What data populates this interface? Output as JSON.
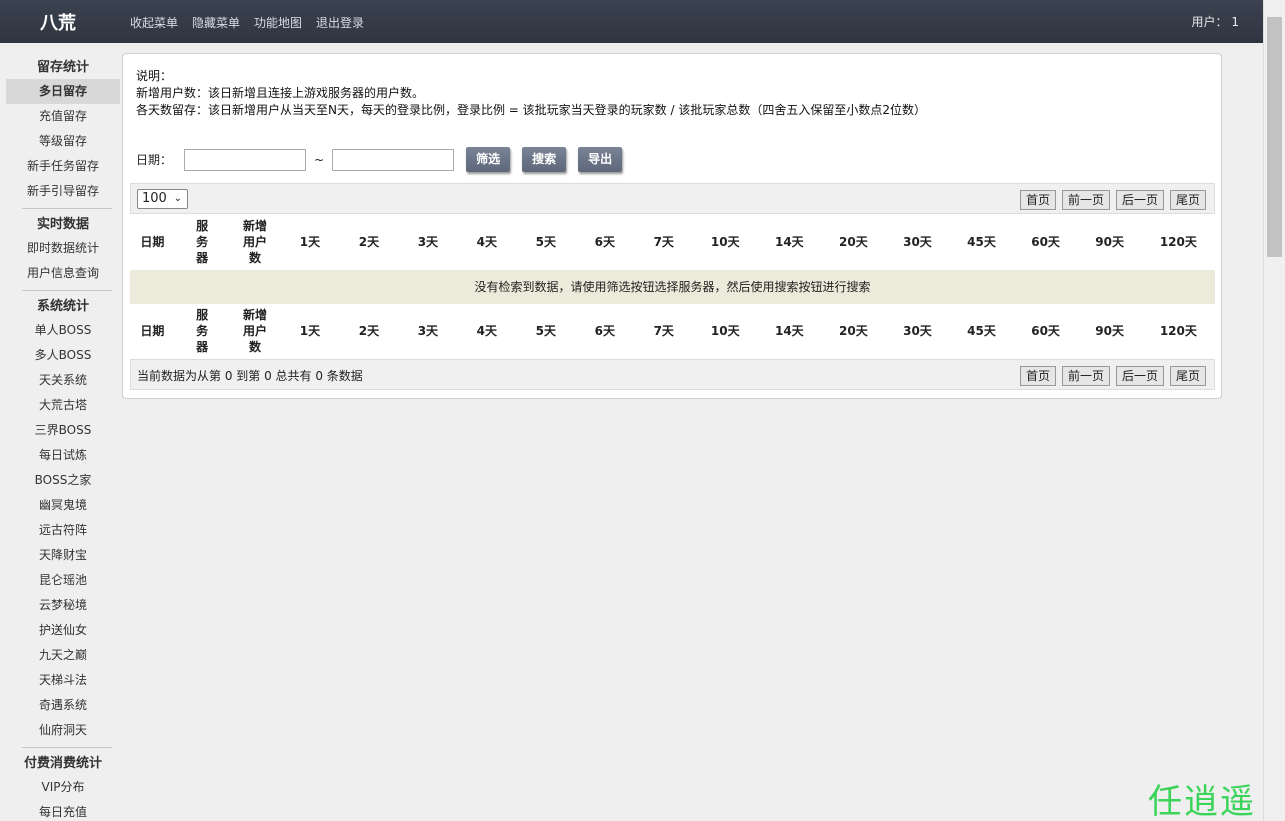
{
  "header": {
    "brand": "八荒",
    "nav": [
      "收起菜单",
      "隐藏菜单",
      "功能地图",
      "退出登录"
    ],
    "user": "用户： 1"
  },
  "sidebar": {
    "groups": [
      {
        "title": "留存统计",
        "items": [
          "多日留存",
          "充值留存",
          "等级留存",
          "新手任务留存",
          "新手引导留存"
        ],
        "active": 0
      },
      {
        "title": "实时数据",
        "items": [
          "即时数据统计",
          "用户信息查询"
        ]
      },
      {
        "title": "系统统计",
        "items": [
          "单人BOSS",
          "多人BOSS",
          "天关系统",
          "大荒古塔",
          "三界BOSS",
          "每日试炼",
          "BOSS之家",
          "幽冥鬼境",
          "远古符阵",
          "天降财宝",
          "昆仑瑶池",
          "云梦秘境",
          "护送仙女",
          "九天之巅",
          "天梯斗法",
          "奇遇系统",
          "仙府洞天"
        ]
      },
      {
        "title": "付费消费统计",
        "items": [
          "VIP分布",
          "每日充值"
        ]
      }
    ]
  },
  "description": {
    "line1": "说明：",
    "line2": "新增用户数：该日新增且连接上游戏服务器的用户数。",
    "line3": "各天数留存：该日新增用户从当天至N天，每天的登录比例，登录比例 = 该批玩家当天登录的玩家数 / 该批玩家总数（四舍五入保留至小数点2位数）"
  },
  "filter": {
    "date_label": "日期：",
    "tilde": "~",
    "filter_btn": "筛选",
    "search_btn": "搜索",
    "export_btn": "导出"
  },
  "table": {
    "page_size": "100",
    "pager": [
      "首页",
      "前一页",
      "后一页",
      "尾页"
    ],
    "columns": [
      "日期",
      "服务器",
      "新增用户数",
      "1天",
      "2天",
      "3天",
      "4天",
      "5天",
      "6天",
      "7天",
      "10天",
      "14天",
      "20天",
      "30天",
      "45天",
      "60天",
      "90天",
      "120天"
    ],
    "empty_message": "没有检索到数据，请使用筛选按钮选择服务器，然后使用搜索按钮进行搜索",
    "info": "当前数据为从第 0 到第 0 总共有 0 条数据"
  },
  "watermark": "任逍遥"
}
